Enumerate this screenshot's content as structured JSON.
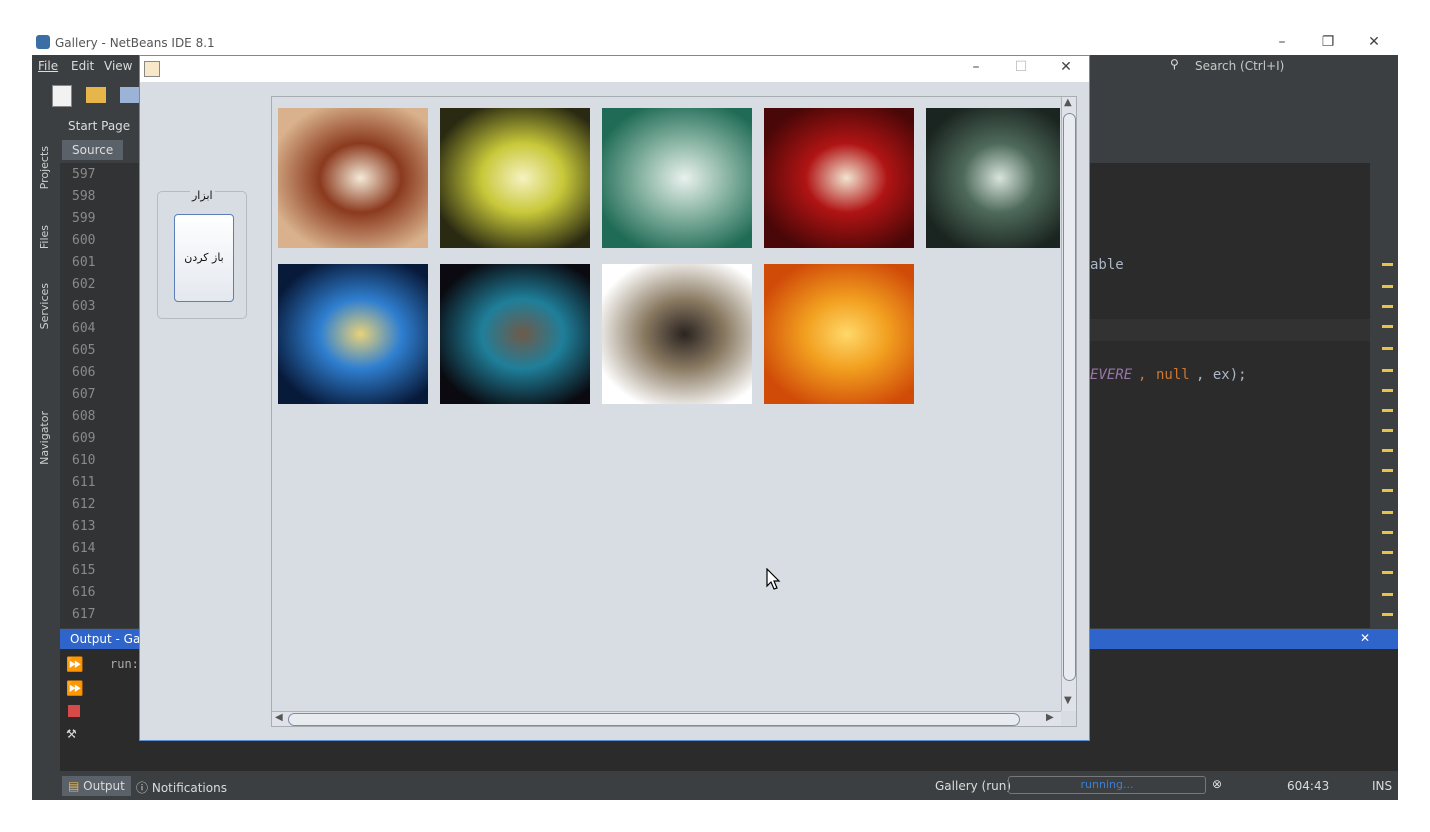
{
  "netbeans": {
    "title": "Gallery - NetBeans IDE 8.1",
    "menu": [
      "File",
      "Edit",
      "View"
    ],
    "search_placeholder": "Search (Ctrl+I)",
    "editor_tab": "Start Page",
    "source_tab": "Source",
    "side_tabs": [
      "Projects",
      "Files",
      "Services",
      "Navigator"
    ],
    "line_numbers": [
      "597",
      "598",
      "599",
      "600",
      "601",
      "602",
      "603",
      "604",
      "605",
      "606",
      "607",
      "608",
      "609",
      "610",
      "611",
      "612",
      "613",
      "614",
      "615",
      "616",
      "617"
    ],
    "code_fragments": {
      "able": "able",
      "severe": "EVERE",
      "null": "null",
      "ex": ", ex);",
      "comma": ", "
    },
    "output_title": "Output - Gall",
    "output_text": "run:",
    "status": {
      "output_tab": "Output",
      "notifications_tab": "Notifications",
      "run_label": "Gallery (run)",
      "progress_text": "running...",
      "position": "604:43",
      "mode": "INS"
    }
  },
  "dialog": {
    "toolbox_title": "ابزار",
    "open_button": "باز کردن",
    "images": [
      {
        "name": "quran-rose",
        "colors": [
          "#d9b28d",
          "#8b3a1e",
          "#f4ead8"
        ]
      },
      {
        "name": "quran-lantern",
        "colors": [
          "#2a2a12",
          "#c8c83a",
          "#f6f2c0"
        ]
      },
      {
        "name": "green-calligraphy",
        "colors": [
          "#1f6b55",
          "#8fb8a8",
          "#e9f1ee"
        ]
      },
      {
        "name": "red-calligraphy",
        "colors": [
          "#4a0707",
          "#b01414",
          "#f2e4d0"
        ]
      },
      {
        "name": "dark-landscape",
        "colors": [
          "#1a2420",
          "#4e6a5a",
          "#d8e4dc"
        ]
      },
      {
        "name": "blue-shrine",
        "colors": [
          "#081a3a",
          "#2f7fd0",
          "#e8d27a"
        ]
      },
      {
        "name": "dark-dome",
        "colors": [
          "#0a0a10",
          "#1f7f9a",
          "#6f5a4a"
        ]
      },
      {
        "name": "white-tower",
        "colors": [
          "#ffffff",
          "#8a7a62",
          "#2a2320"
        ]
      },
      {
        "name": "orange-glow",
        "colors": [
          "#d04a08",
          "#f2a020",
          "#ffd86a"
        ]
      }
    ]
  },
  "colors": {
    "accent": "#2f65ca",
    "running": "#3d7fd0"
  }
}
